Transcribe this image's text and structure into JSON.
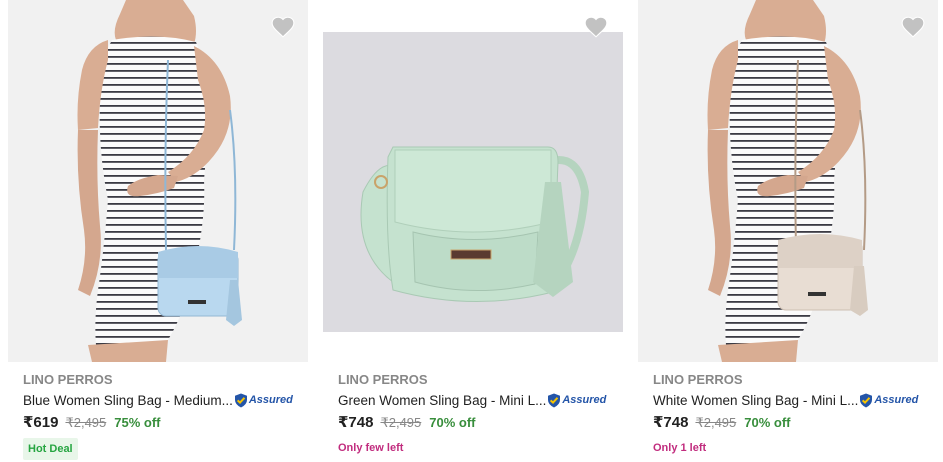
{
  "colors": {
    "accent": "#2874f0",
    "brand_text": "#878787",
    "discount": "#388e3c",
    "stock_warning": "#c12c7e",
    "hot_deal_bg": "#e8f6e9",
    "hot_deal_text": "#26a541"
  },
  "products": [
    {
      "brand": "LINO PERROS",
      "title": "Blue Women Sling Bag - Medium...",
      "assured_label": "Assured",
      "price": "₹619",
      "mrp": "₹2,495",
      "discount": "75% off",
      "badge": "Hot Deal",
      "bag_color": "#b9d8ef",
      "icon": "heart-icon"
    },
    {
      "brand": "LINO PERROS",
      "title": "Green Women Sling Bag - Mini L...",
      "assured_label": "Assured",
      "price": "₹748",
      "mrp": "₹2,495",
      "discount": "70% off",
      "stock_note": "Only few left",
      "bag_color": "#c5e2cf",
      "icon": "heart-icon"
    },
    {
      "brand": "LINO PERROS",
      "title": "White Women Sling Bag - Mini L...",
      "assured_label": "Assured",
      "price": "₹748",
      "mrp": "₹2,495",
      "discount": "70% off",
      "stock_note": "Only 1 left",
      "bag_color": "#e8ddd3",
      "icon": "heart-icon"
    }
  ]
}
